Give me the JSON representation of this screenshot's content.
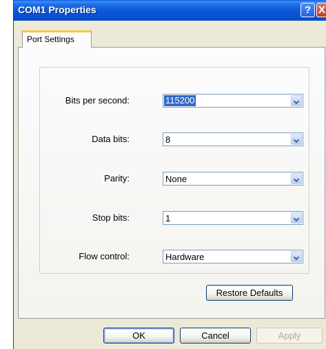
{
  "window": {
    "title": "COM1 Properties",
    "help_glyph": "?",
    "close_glyph": "X"
  },
  "tabs": [
    {
      "label": "Port Settings",
      "selected": true
    }
  ],
  "settings": [
    {
      "label": "Bits per second:",
      "value": "115200",
      "focused": true
    },
    {
      "label": "Data bits:",
      "value": "8"
    },
    {
      "label": "Parity:",
      "value": "None"
    },
    {
      "label": "Stop bits:",
      "value": "1"
    },
    {
      "label": "Flow control:",
      "value": "Hardware"
    }
  ],
  "buttons": {
    "restore": "Restore Defaults",
    "ok": "OK",
    "cancel": "Cancel",
    "apply": "Apply"
  },
  "colors": {
    "titlebar": "#0a56d9",
    "selection": "#316ac5",
    "tab_accent": "#ffc83c"
  }
}
